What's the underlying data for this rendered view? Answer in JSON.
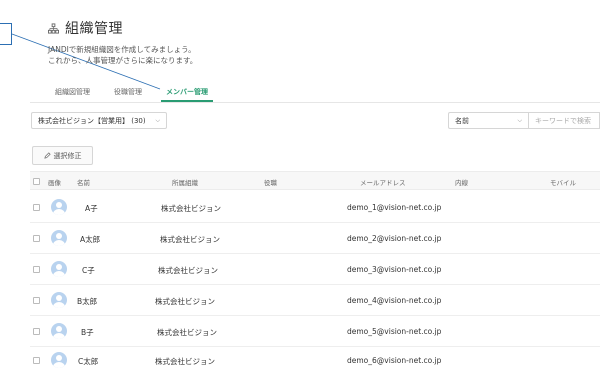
{
  "header": {
    "title": "組織管理",
    "description_line1": "JANDIで新規組織図を作成してみましょう。",
    "description_line2": "これから、人事管理がさらに楽になります。"
  },
  "tabs": [
    {
      "label": "組織図管理",
      "active": false
    },
    {
      "label": "役職管理",
      "active": false
    },
    {
      "label": "メンバー管理",
      "active": true
    }
  ],
  "filters": {
    "org_select": "株式会社ビジョン【営業用】 (30)",
    "name_select": "名前",
    "search_placeholder": "キーワードで検索"
  },
  "toolbar": {
    "edit_label": "選択修正"
  },
  "table": {
    "headers": {
      "photo": "画像",
      "name": "名前",
      "org": "所属組織",
      "position": "役職",
      "email": "メールアドレス",
      "extension": "内線",
      "mobile": "モバイル"
    },
    "rows": [
      {
        "name": "A子",
        "org": "株式会社ビジョン",
        "position": "",
        "email": "demo_1@vision-net.co.jp",
        "extension": "",
        "mobile": ""
      },
      {
        "name": "A太郎",
        "org": "株式会社ビジョン",
        "position": "",
        "email": "demo_2@vision-net.co.jp",
        "extension": "",
        "mobile": ""
      },
      {
        "name": "C子",
        "org": "株式会社ビジョン",
        "position": "",
        "email": "demo_3@vision-net.co.jp",
        "extension": "",
        "mobile": ""
      },
      {
        "name": "B太郎",
        "org": "株式会社ビジョン",
        "position": "",
        "email": "demo_4@vision-net.co.jp",
        "extension": "",
        "mobile": ""
      },
      {
        "name": "B子",
        "org": "株式会社ビジョン",
        "position": "",
        "email": "demo_5@vision-net.co.jp",
        "extension": "",
        "mobile": ""
      },
      {
        "name": "C太郎",
        "org": "株式会社ビジョン",
        "position": "",
        "email": "demo_6@vision-net.co.jp",
        "extension": "",
        "mobile": ""
      }
    ]
  },
  "colors": {
    "accent": "#2a9c73",
    "avatar": "#b9d3ef",
    "callout": "#2c6fb3"
  }
}
